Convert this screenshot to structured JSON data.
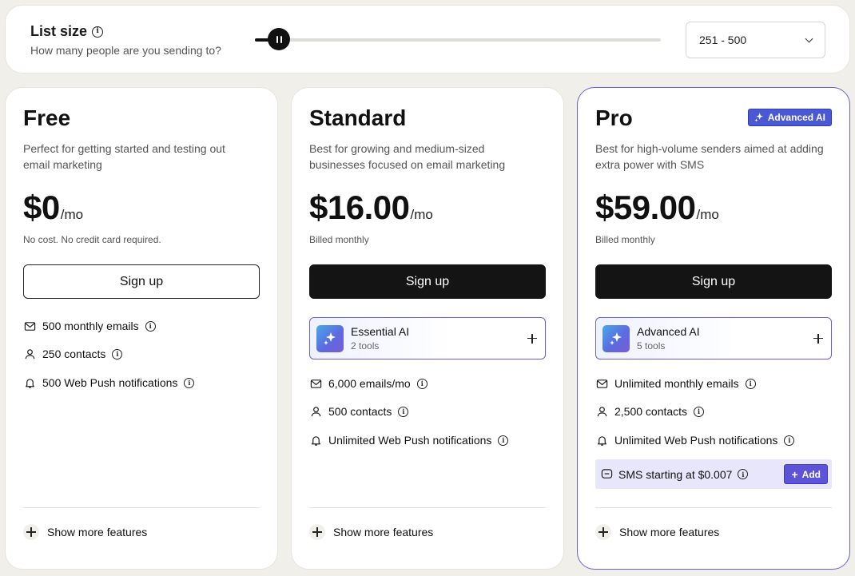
{
  "list_size": {
    "title": "List size",
    "subtitle": "How many people are you sending to?",
    "slider_level": 0.04,
    "selected": "251 - 500"
  },
  "plans": [
    {
      "name": "Free",
      "description": "Perfect for getting started and testing out email marketing",
      "price": "$0",
      "per": "/mo",
      "billing": "No cost. No credit card required.",
      "cta": "Sign up",
      "features": [
        "500 monthly emails",
        "250 contacts",
        "500 Web Push notifications"
      ],
      "show_more": "Show more features"
    },
    {
      "name": "Standard",
      "description": "Best for growing and medium-sized businesses focused on email marketing",
      "price": "$16.00",
      "per": "/mo",
      "billing": "Billed monthly",
      "cta": "Sign up",
      "ai": {
        "title": "Essential AI",
        "subtitle": "2 tools"
      },
      "features": [
        "6,000 emails/mo",
        "500 contacts",
        "Unlimited Web Push notifications"
      ],
      "show_more": "Show more features"
    },
    {
      "name": "Pro",
      "badge": "Advanced AI",
      "description": "Best for high-volume senders aimed at adding extra power with SMS",
      "price": "$59.00",
      "per": "/mo",
      "billing": "Billed monthly",
      "cta": "Sign up",
      "ai": {
        "title": "Advanced AI",
        "subtitle": "5 tools"
      },
      "features": [
        "Unlimited monthly emails",
        "2,500 contacts",
        "Unlimited Web Push notifications"
      ],
      "sms": {
        "text": "SMS starting at $0.007",
        "add_label": "Add"
      },
      "show_more": "Show more features"
    }
  ],
  "colors": {
    "accent": "#6a5fd6",
    "badge": "#4a58d6",
    "cta_dark": "#141414",
    "sms_bg": "#e8e6fb"
  },
  "icons": [
    "info-icon",
    "chevron-down-icon",
    "mail-icon",
    "user-icon",
    "bell-icon",
    "sparkle-icon",
    "plus-icon",
    "message-icon"
  ]
}
